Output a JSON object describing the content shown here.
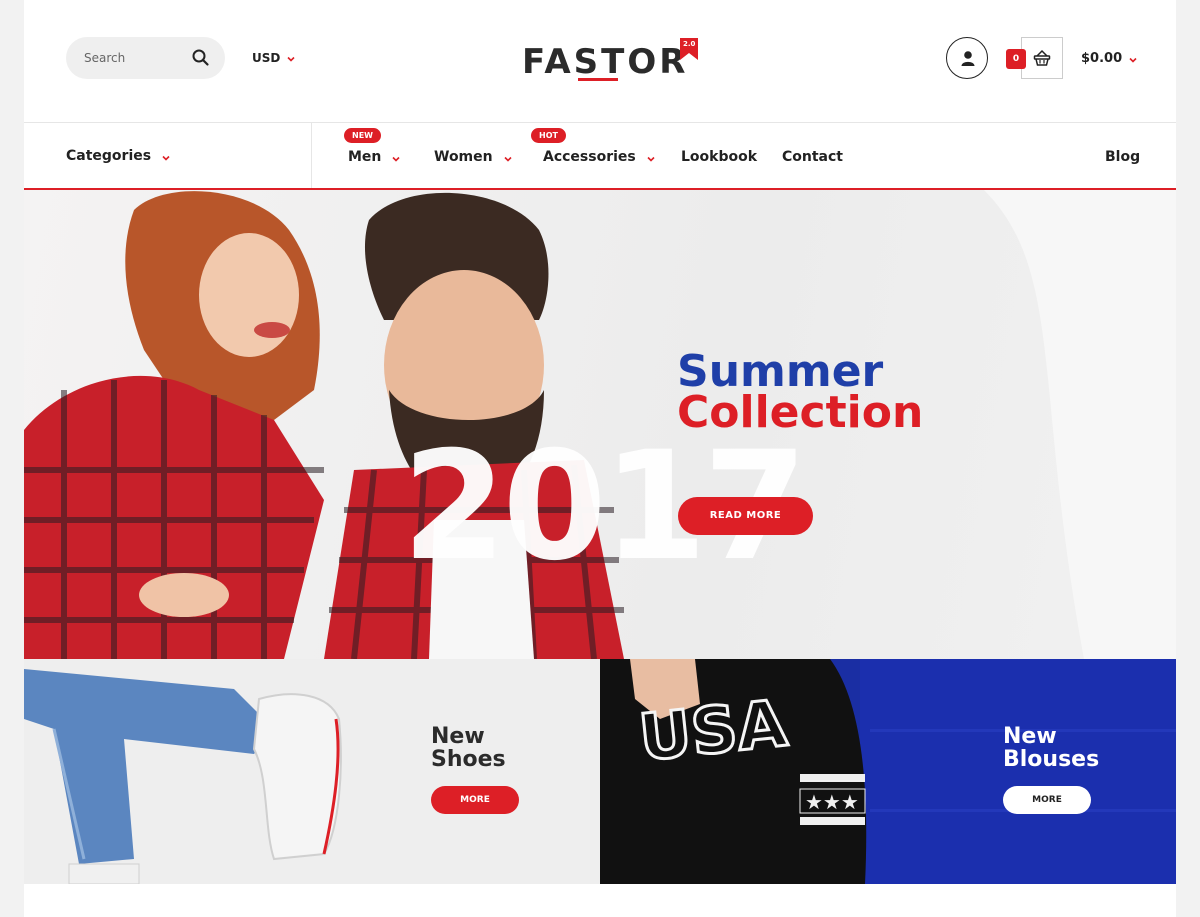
{
  "header": {
    "search_placeholder": "Search",
    "currency": "USD",
    "logo_text": "FASTOR",
    "logo_version": "2.0",
    "cart_count": "0",
    "cart_total": "$0.00"
  },
  "nav": {
    "categories_label": "Categories",
    "items": [
      {
        "label": "Men",
        "badge": "NEW"
      },
      {
        "label": "Women",
        "badge": ""
      },
      {
        "label": "Accessories",
        "badge": "HOT"
      },
      {
        "label": "Lookbook",
        "badge": ""
      },
      {
        "label": "Contact",
        "badge": ""
      },
      {
        "label": "Blog",
        "badge": ""
      }
    ]
  },
  "hero": {
    "title_line1": "Summer",
    "title_line2": "Collection",
    "year": "2017",
    "button": "READ MORE"
  },
  "banners": [
    {
      "title_line1": "New",
      "title_line2": "Shoes",
      "button": "MORE"
    },
    {
      "title_line1": "New",
      "title_line2": "Blouses",
      "button": "MORE"
    }
  ],
  "colors": {
    "accent": "#dd1f26",
    "brand_blue": "#1f3fa8",
    "text": "#222222"
  },
  "icons": {
    "search": "search-icon",
    "chevron": "chevron-down-icon",
    "account": "user-icon",
    "cart": "basket-icon"
  }
}
